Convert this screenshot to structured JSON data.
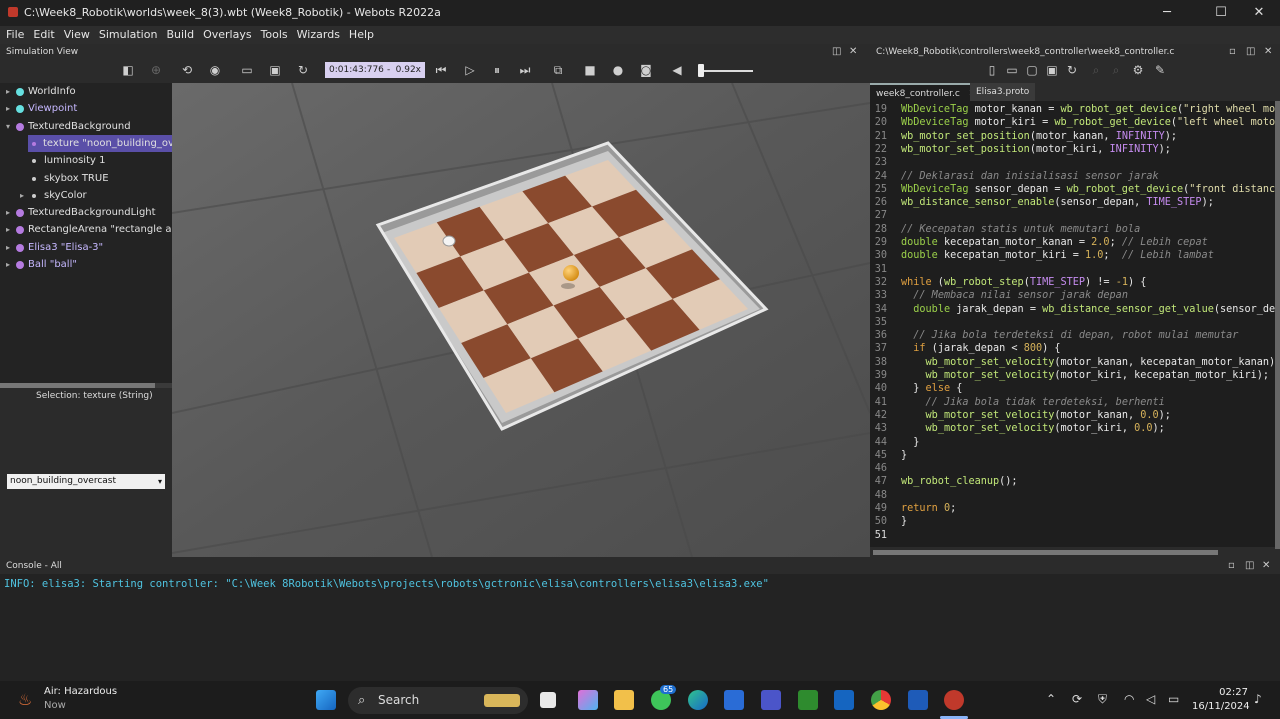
{
  "window": {
    "title": "C:\\Week8_Robotik\\worlds\\week_8(3).wbt (Week8_Robotik) - Webots R2022a",
    "minimize": "─",
    "maximize": "☐",
    "close": "✕"
  },
  "menu": [
    "File",
    "Edit",
    "View",
    "Simulation",
    "Build",
    "Overlays",
    "Tools",
    "Wizards",
    "Help"
  ],
  "simulation_view": {
    "title": "Simulation View",
    "time": "0:01:43:776",
    "speed_sep": "-",
    "speed": "0.92x"
  },
  "scene_tree": [
    {
      "label": "WorldInfo",
      "color": "#66e0e0",
      "expandable": true,
      "indent": 0
    },
    {
      "label": "Viewpoint",
      "color": "#66e0e0",
      "expandable": true,
      "indent": 0,
      "highlight": true
    },
    {
      "label": "TexturedBackground",
      "color": "#b57be0",
      "expandable": true,
      "expanded": true,
      "indent": 0
    },
    {
      "label": "texture \"noon_building_overc",
      "color": "#b57be0",
      "expandable": false,
      "indent": 1,
      "selected": true
    },
    {
      "label": "luminosity 1",
      "color": "#cccccc",
      "expandable": false,
      "indent": 1
    },
    {
      "label": "skybox TRUE",
      "color": "#cccccc",
      "expandable": false,
      "indent": 1
    },
    {
      "label": "skyColor",
      "color": "#cccccc",
      "expandable": true,
      "indent": 1
    },
    {
      "label": "TexturedBackgroundLight",
      "color": "#b57be0",
      "expandable": true,
      "indent": 0
    },
    {
      "label": "RectangleArena \"rectangle arena",
      "color": "#b57be0",
      "expandable": true,
      "indent": 0
    },
    {
      "label": "Elisa3 \"Elisa-3\"",
      "color": "#b57be0",
      "expandable": true,
      "indent": 0,
      "highlight": true
    },
    {
      "label": "Ball \"ball\"",
      "color": "#b57be0",
      "expandable": true,
      "indent": 0,
      "highlight": true
    }
  ],
  "selection": {
    "label": "Selection: texture (String)",
    "value": "noon_building_overcast"
  },
  "editor": {
    "title": "C:\\Week8_Robotik\\controllers\\week8_controller\\week8_controller.c",
    "tabs": [
      "week8_controller.c",
      "Elisa3.proto"
    ],
    "lines": [
      {
        "n": "19",
        "t": "WbDeviceTag motor_kanan = wb_robot_get_device(\"right wheel mot"
      },
      {
        "n": "20",
        "t": "WbDeviceTag motor_kiri = wb_robot_get_device(\"left wheel motor"
      },
      {
        "n": "21",
        "t": "wb_motor_set_position(motor_kanan, INFINITY);"
      },
      {
        "n": "22",
        "t": "wb_motor_set_position(motor_kiri, INFINITY);"
      },
      {
        "n": "23",
        "t": ""
      },
      {
        "n": "24",
        "t": "// Deklarasi dan inisialisasi sensor jarak"
      },
      {
        "n": "25",
        "t": "WbDeviceTag sensor_depan = wb_robot_get_device(\"front distance"
      },
      {
        "n": "26",
        "t": "wb_distance_sensor_enable(sensor_depan, TIME_STEP);"
      },
      {
        "n": "27",
        "t": ""
      },
      {
        "n": "28",
        "t": "// Kecepatan statis untuk memutari bola"
      },
      {
        "n": "29",
        "t": "double kecepatan_motor_kanan = 2.0; // Lebih cepat"
      },
      {
        "n": "30",
        "t": "double kecepatan_motor_kiri = 1.0;  // Lebih lambat"
      },
      {
        "n": "31",
        "t": ""
      },
      {
        "n": "32",
        "t": "while (wb_robot_step(TIME_STEP) != -1) {"
      },
      {
        "n": "33",
        "t": "  // Membaca nilai sensor jarak depan"
      },
      {
        "n": "34",
        "t": "  double jarak_depan = wb_distance_sensor_get_value(sensor_dep"
      },
      {
        "n": "35",
        "t": ""
      },
      {
        "n": "36",
        "t": "  // Jika bola terdeteksi di depan, robot mulai memutar"
      },
      {
        "n": "37",
        "t": "  if (jarak_depan < 800) {"
      },
      {
        "n": "38",
        "t": "    wb_motor_set_velocity(motor_kanan, kecepatan_motor_kanan);"
      },
      {
        "n": "39",
        "t": "    wb_motor_set_velocity(motor_kiri, kecepatan_motor_kiri);"
      },
      {
        "n": "40",
        "t": "  } else {"
      },
      {
        "n": "41",
        "t": "    // Jika bola tidak terdeteksi, berhenti"
      },
      {
        "n": "42",
        "t": "    wb_motor_set_velocity(motor_kanan, 0.0);"
      },
      {
        "n": "43",
        "t": "    wb_motor_set_velocity(motor_kiri, 0.0);"
      },
      {
        "n": "44",
        "t": "  }"
      },
      {
        "n": "45",
        "t": "}"
      },
      {
        "n": "46",
        "t": ""
      },
      {
        "n": "47",
        "t": "wb_robot_cleanup();"
      },
      {
        "n": "48",
        "t": ""
      },
      {
        "n": "49",
        "t": "return 0;"
      },
      {
        "n": "50",
        "t": "}"
      },
      {
        "n": "51",
        "t": ""
      }
    ]
  },
  "console": {
    "title": "Console - All",
    "text": "INFO: elisa3: Starting controller: \"C:\\Week 8Robotik\\Webots\\projects\\robots\\gctronic\\elisa\\controllers\\elisa3\\elisa3.exe\""
  },
  "taskbar": {
    "weather_title": "Air: Hazardous",
    "weather_sub": "Now",
    "search": "Search",
    "badge": "65",
    "time": "02:27",
    "date": "16/11/2024"
  }
}
